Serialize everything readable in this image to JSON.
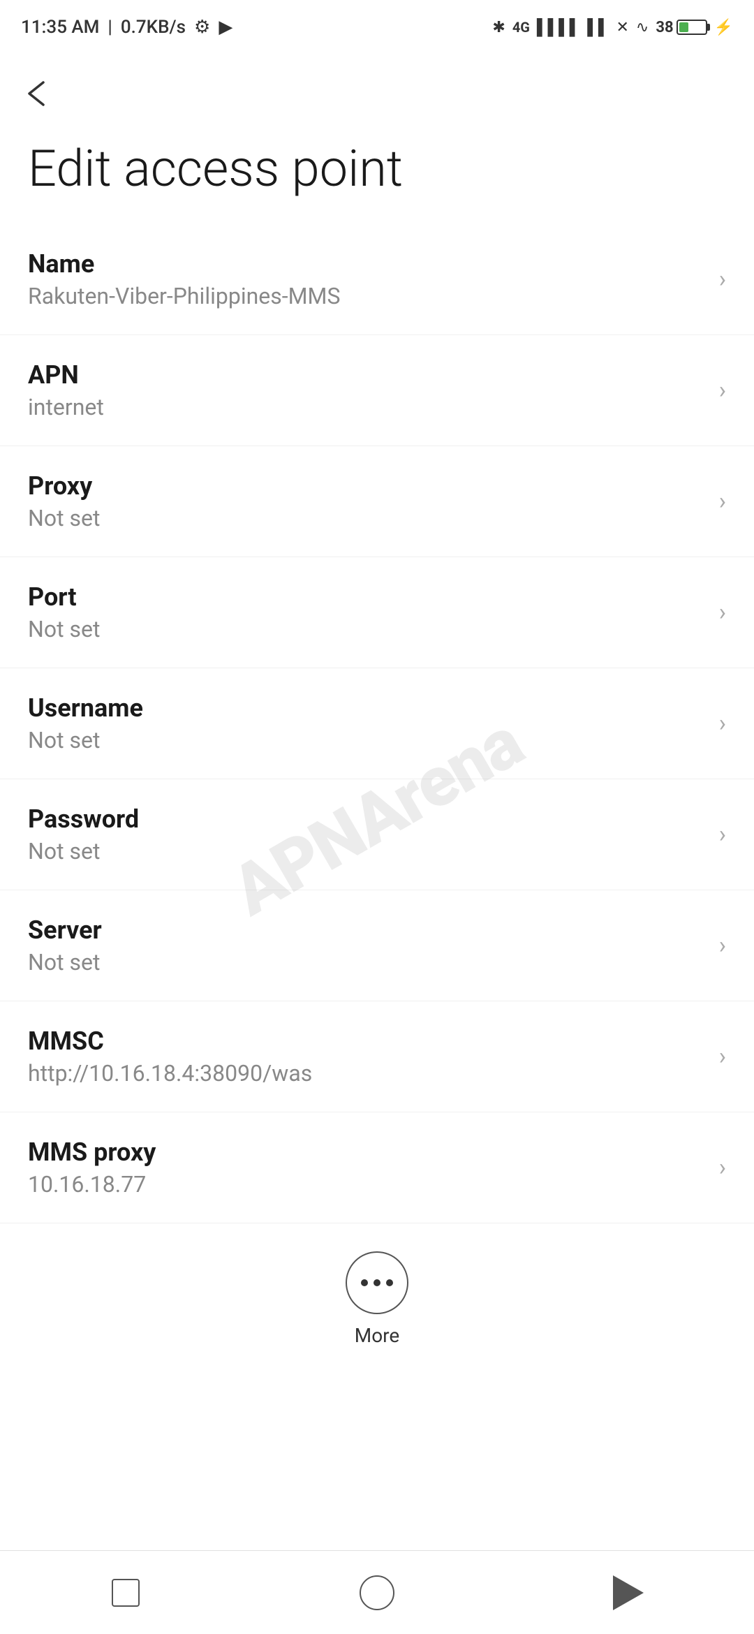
{
  "statusBar": {
    "time": "11:35 AM",
    "speed": "0.7KB/s"
  },
  "pageTitle": "Edit access point",
  "backLabel": "back",
  "settings": [
    {
      "id": "name",
      "label": "Name",
      "value": "Rakuten-Viber-Philippines-MMS"
    },
    {
      "id": "apn",
      "label": "APN",
      "value": "internet"
    },
    {
      "id": "proxy",
      "label": "Proxy",
      "value": "Not set"
    },
    {
      "id": "port",
      "label": "Port",
      "value": "Not set"
    },
    {
      "id": "username",
      "label": "Username",
      "value": "Not set"
    },
    {
      "id": "password",
      "label": "Password",
      "value": "Not set"
    },
    {
      "id": "server",
      "label": "Server",
      "value": "Not set"
    },
    {
      "id": "mmsc",
      "label": "MMSC",
      "value": "http://10.16.18.4:38090/was"
    },
    {
      "id": "mms-proxy",
      "label": "MMS proxy",
      "value": "10.16.18.77"
    }
  ],
  "moreButton": {
    "label": "More"
  },
  "watermark": "APNArena"
}
